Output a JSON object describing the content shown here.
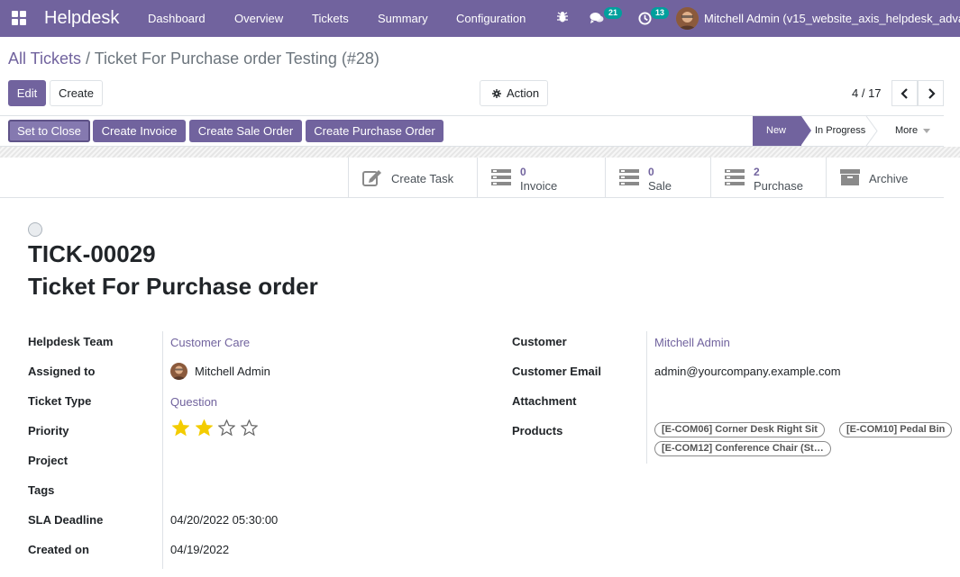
{
  "navbar": {
    "brand": "Helpdesk",
    "menu": [
      "Dashboard",
      "Overview",
      "Tickets",
      "Summary",
      "Configuration"
    ],
    "chat_count": "21",
    "activity_count": "13",
    "user": "Mitchell Admin (v15_website_axis_helpdesk_adva"
  },
  "breadcrumb": {
    "parent": "All Tickets",
    "separator": " / ",
    "current": "Ticket For Purchase order Testing (#28)"
  },
  "buttons": {
    "edit": "Edit",
    "create": "Create",
    "action": "Action"
  },
  "pager": {
    "text": "4 / 17"
  },
  "header_buttons": [
    "Set to Close",
    "Create Invoice",
    "Create Sale Order",
    "Create Purchase Order"
  ],
  "stages": {
    "new": "New",
    "in_progress": "In Progress",
    "more": "More"
  },
  "smart_buttons": {
    "create_task": "Create Task",
    "invoice": {
      "count": "0",
      "label": "Invoice"
    },
    "sale": {
      "count": "0",
      "label": "Sale"
    },
    "purchase": {
      "count": "2",
      "label": "Purchase"
    },
    "archive": "Archive"
  },
  "ticket": {
    "number": "TICK-00029",
    "name": "Ticket For Purchase order"
  },
  "fields": {
    "helpdesk_team": {
      "label": "Helpdesk Team",
      "value": "Customer Care"
    },
    "assigned_to": {
      "label": "Assigned to",
      "value": "Mitchell Admin"
    },
    "ticket_type": {
      "label": "Ticket Type",
      "value": "Question"
    },
    "priority": {
      "label": "Priority",
      "stars": 2,
      "max": 4
    },
    "project": {
      "label": "Project",
      "value": ""
    },
    "tags": {
      "label": "Tags",
      "value": ""
    },
    "sla_deadline": {
      "label": "SLA Deadline",
      "value": "04/20/2022 05:30:00"
    },
    "created_on": {
      "label": "Created on",
      "value": "04/19/2022"
    },
    "customer": {
      "label": "Customer",
      "value": "Mitchell Admin"
    },
    "customer_email": {
      "label": "Customer Email",
      "value": "admin@yourcompany.example.com"
    },
    "attachment": {
      "label": "Attachment",
      "value": ""
    },
    "products": {
      "label": "Products",
      "tags": [
        "[E-COM06] Corner Desk Right Sit",
        "[E-COM10] Pedal Bin",
        "[E-COM12] Conference Chair (St…"
      ]
    }
  },
  "colors": {
    "primary": "#71639e",
    "star": "#f3cc00",
    "badge": "#00a09d"
  }
}
